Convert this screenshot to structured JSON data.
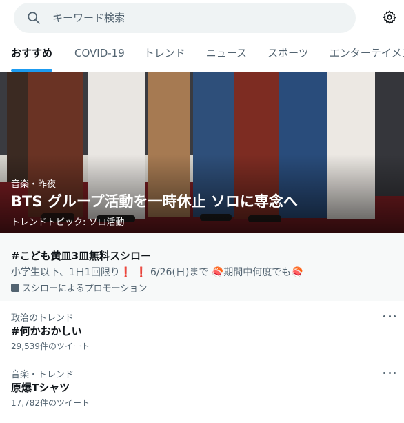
{
  "search": {
    "placeholder": "キーワード検索"
  },
  "icons": {
    "search": "search-icon",
    "settings": "gear-icon",
    "more": "more-dots-icon",
    "promoted": "promoted-icon"
  },
  "tabs": [
    {
      "label": "おすすめ",
      "active": true
    },
    {
      "label": "COVID-19",
      "active": false
    },
    {
      "label": "トレンド",
      "active": false
    },
    {
      "label": "ニュース",
      "active": false
    },
    {
      "label": "スポーツ",
      "active": false
    },
    {
      "label": "エンターテイメン",
      "active": false
    }
  ],
  "hero": {
    "meta": "音楽・昨夜",
    "title": "BTS グループ活動を一時休止 ソロに専念へ",
    "subtitle": "トレンドトピック: ソロ活動"
  },
  "promo": {
    "title": "#こども黄皿3皿無料スシロー",
    "desc_before": "小学生以下、1日1回限り",
    "desc_mark": "❗ ❗",
    "desc_after": " 6/26(日)まで 🍣期間中何度でも🍣",
    "promoted_by": "スシローによるプロモーション"
  },
  "trends": [
    {
      "category": "政治のトレンド",
      "name": "#何かおかしい",
      "count": "29,539件のツイート"
    },
    {
      "category": "音楽・トレンド",
      "name": "原爆Tシャツ",
      "count": "17,782件のツイート"
    }
  ],
  "colors": {
    "accent": "#1d9bf0",
    "text": "#0f1419",
    "secondary": "#536471",
    "promo_bg": "#f7f9f9",
    "search_bg": "#eff3f4"
  }
}
